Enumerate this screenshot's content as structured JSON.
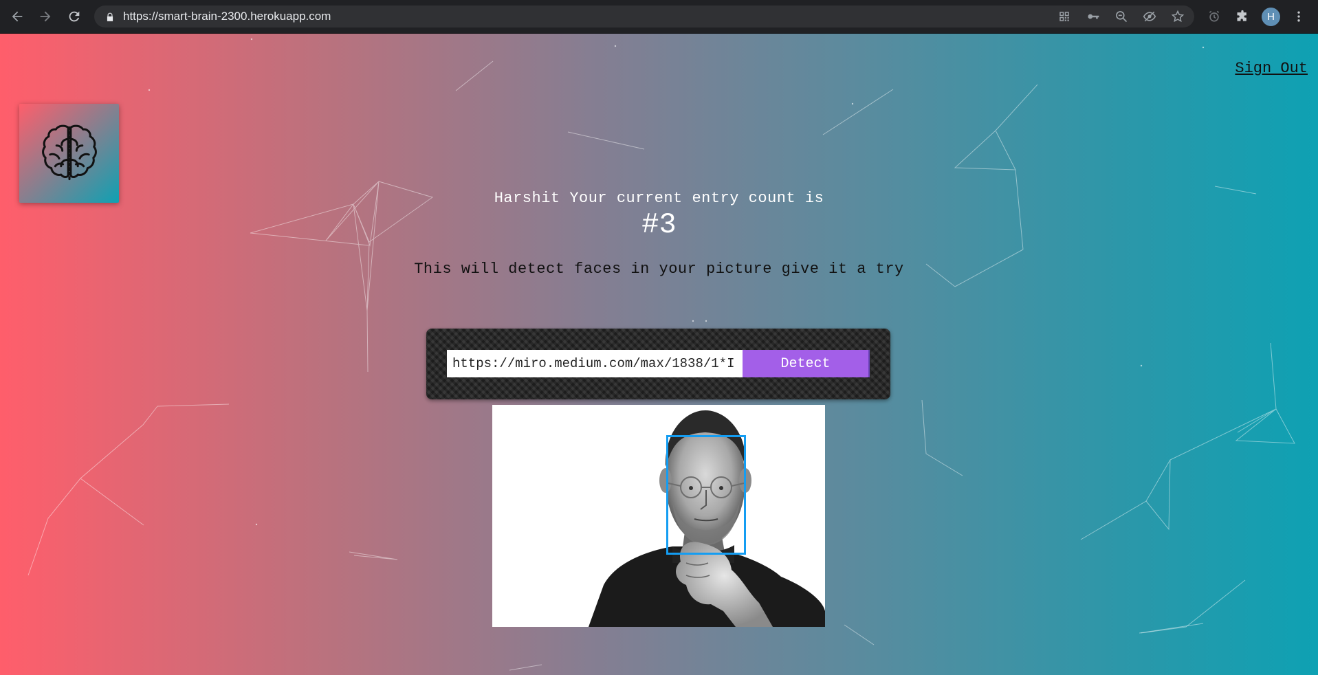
{
  "browser": {
    "url": "https://smart-brain-2300.herokuapp.com",
    "profile_initial": "H",
    "icons": [
      "back-icon",
      "forward-icon",
      "reload-icon",
      "lock-icon",
      "qr-code-icon",
      "key-icon",
      "zoom-out-icon",
      "eye-slash-icon",
      "star-icon",
      "alarm-icon",
      "puzzle-icon",
      "more-vert-icon"
    ]
  },
  "nav": {
    "sign_out": "Sign Out"
  },
  "logo": {
    "icon": "brain-icon"
  },
  "rank": {
    "message": "Harshit Your current entry count is",
    "count": "#3"
  },
  "tagline": "This will detect faces in your picture give it a try",
  "form": {
    "input_value": "https://miro.medium.com/max/1838/1*I",
    "button_label": "Detect"
  },
  "colors": {
    "gradient_start": "#ff5e6b",
    "gradient_end": "#0ea1b3",
    "button": "#a35fe8",
    "face_box": "#149df2"
  }
}
